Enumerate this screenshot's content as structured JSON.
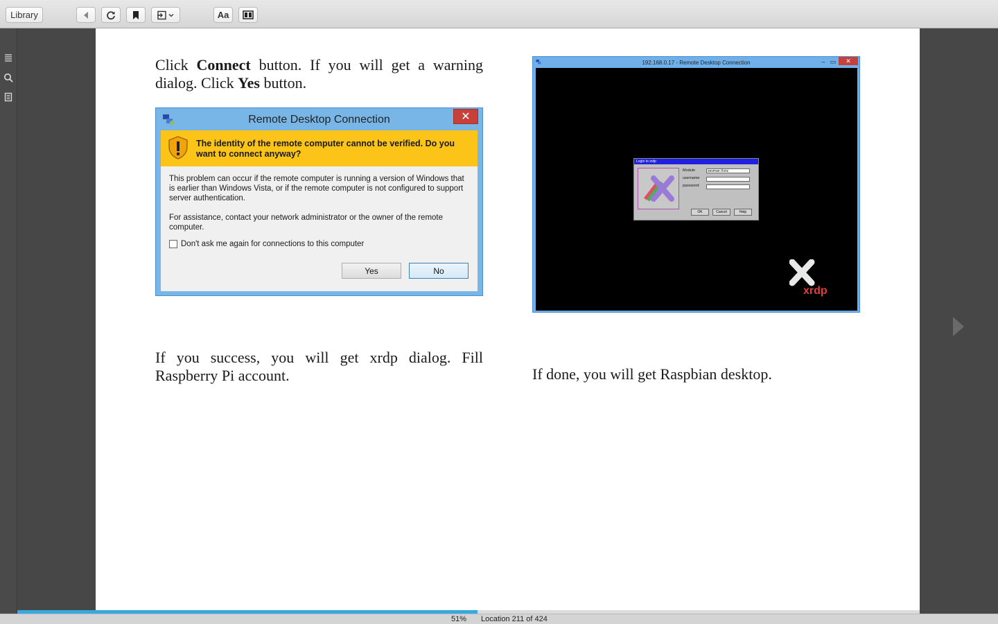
{
  "toolbar": {
    "library_label": "Library",
    "font_label": "Aa"
  },
  "page": {
    "left_top_text": {
      "p1": "Click ",
      "b1": "Connect",
      "p2": " button. If you will get a warning dialog. Click ",
      "b2": "Yes",
      "p3": " button."
    },
    "left_bottom_text": "If you success, you will get xrdp dialog. Fill Raspberry Pi account.",
    "right_bottom_text": "If done, you will get Raspbian desktop."
  },
  "rdc_dialog": {
    "title": "Remote Desktop Connection",
    "close": "✕",
    "warning": "The identity of the remote computer cannot be verified. Do you want to connect anyway?",
    "body1": "This problem can occur if the remote computer is running a version of Windows that is earlier than Windows Vista, or if the remote computer is not configured to support server authentication.",
    "body2": "For assistance, contact your network administrator or the owner of the remote computer.",
    "checkbox_label": "Don't ask me again for connections to this computer",
    "yes": "Yes",
    "no": "No"
  },
  "rdp_window": {
    "title": "192.168.0.17 - Remote Desktop Connection",
    "close": "✕",
    "minimize": "–",
    "maximize": "▭",
    "xrdp_dialog": {
      "title": "Login to xrdp",
      "module_label": "Module",
      "module_value": "sesman-Xvnc",
      "username_label": "username",
      "password_label": "password",
      "ok": "OK",
      "cancel": "Cancel",
      "help": "Help"
    },
    "logo_text": "xrdp"
  },
  "status": {
    "percent": "51%",
    "location": "Location 211 of 424",
    "progress_fraction": 0.51
  }
}
